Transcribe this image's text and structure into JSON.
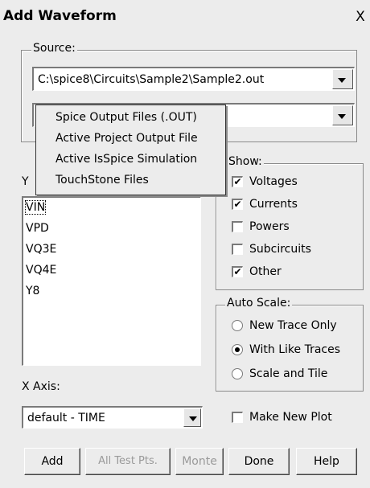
{
  "window": {
    "title": "Add Waveform",
    "close_glyph": "X"
  },
  "source": {
    "label": "Source:",
    "path_value": "C:\\spice8\\Circuits\\Sample2\\Sample2.out",
    "type_value": ""
  },
  "source_type_menu": {
    "items": [
      "Spice Output Files (.OUT)",
      "Active Project Output File",
      "Active IsSpice Simulation",
      "TouchStone Files"
    ]
  },
  "y_axis": {
    "label_visible": "Y",
    "items": [
      "VIN",
      "VPD",
      "VQ3E",
      "VQ4E",
      "Y8"
    ],
    "selected_index": 0
  },
  "show": {
    "label": "Show:",
    "options": [
      {
        "label": "Voltages",
        "checked": true
      },
      {
        "label": "Currents",
        "checked": true
      },
      {
        "label": "Powers",
        "checked": false
      },
      {
        "label": "Subcircuits",
        "checked": false
      },
      {
        "label": "Other",
        "checked": true
      }
    ]
  },
  "auto_scale": {
    "label": "Auto Scale:",
    "options": [
      {
        "label": "New Trace Only",
        "selected": false
      },
      {
        "label": "With Like Traces",
        "selected": true
      },
      {
        "label": "Scale and Tile",
        "selected": false
      }
    ]
  },
  "x_axis": {
    "label": "X Axis:",
    "value": "default - TIME"
  },
  "make_new_plot": {
    "label": "Make New Plot",
    "checked": false
  },
  "buttons": {
    "add": "Add",
    "all_test_pts": "All Test Pts.",
    "monte": "Monte",
    "done": "Done",
    "help": "Help"
  },
  "check_glyph": "✔",
  "colors": {
    "window_bg": "#ececec",
    "field_bg": "#ffffff",
    "disabled_text": "#9a9a9a"
  }
}
